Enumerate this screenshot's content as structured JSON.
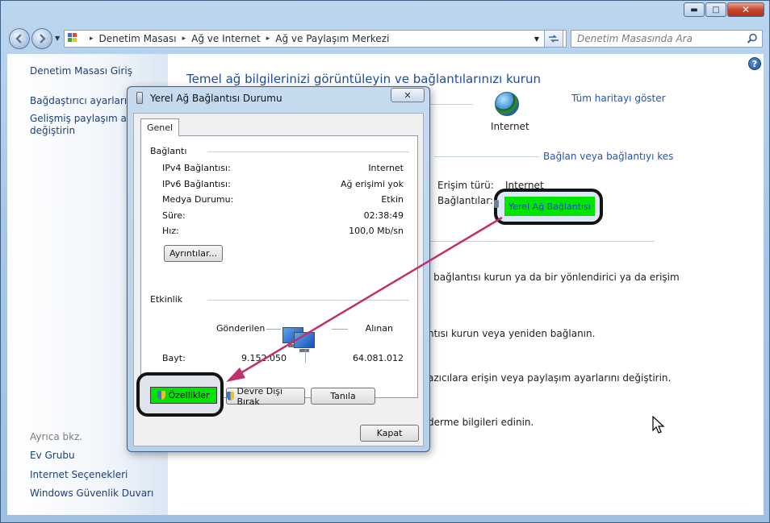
{
  "window": {
    "breadcrumb": [
      "Denetim Masası",
      "Ağ ve Internet",
      "Ağ ve Paylaşım Merkezi"
    ],
    "search_placeholder": "Denetim Masasında Ara",
    "caption_buttons": {
      "minimize": "▬",
      "maximize": "□",
      "close": "✕"
    }
  },
  "sidebar": {
    "home": "Denetim Masası Giriş",
    "items": [
      "Bağdaştırıcı ayarlarını d",
      "Gelişmiş paylaşım ayar",
      "değiştirin"
    ],
    "see_also_label": "Ayrıca bkz.",
    "see_also": [
      "Ev Grubu",
      "Internet Seçenekleri",
      "Windows Güvenlik Duvarı"
    ]
  },
  "main": {
    "title": "Temel ağ bilgilerinizi görüntüleyin ve bağlantılarınızı kurun",
    "full_map_link": "Tüm haritayı göster",
    "internet_label": "Internet",
    "connect_link": "Bağlan veya bağlantıyı kes",
    "access_type_label": "Erişim türü:",
    "access_type_value": "Internet",
    "connections_label": "Bağlantılar:",
    "connection_name": "Yerel Ağ Bağlantısı",
    "tasks": [
      "l bağlantısı kurun ya da bir yönlendirici ya da erişim",
      "ntısı kurun veya yeniden bağlanın.",
      "azıcılara erişin veya paylaşım ayarlarını değiştirin.",
      "derme bilgileri edinin."
    ]
  },
  "dialog": {
    "title": "Yerel Ağ Bağlantısı Durumu",
    "close_glyph": "✕",
    "tab": "Genel",
    "connection_group": "Bağlantı",
    "rows": [
      {
        "label": "IPv4 Bağlantısı:",
        "value": "Internet"
      },
      {
        "label": "IPv6 Bağlantısı:",
        "value": "Ağ erişimi yok"
      },
      {
        "label": "Medya Durumu:",
        "value": "Etkin"
      },
      {
        "label": "Süre:",
        "value": "02:38:49"
      },
      {
        "label": "Hız:",
        "value": "100,0 Mb/sn"
      }
    ],
    "details_button": "Ayrıntılar...",
    "activity_group": "Etkinlik",
    "sent_label": "Gönderilen",
    "received_label": "Alınan",
    "bytes_label": "Bayt:",
    "bytes_sent": "9.152.050",
    "bytes_received": "64.081.012",
    "properties_button": "Özellikler",
    "disable_button": "Devre Dışı Bırak",
    "diagnose_button": "Tanıla",
    "close_button": "Kapat"
  },
  "colors": {
    "highlight_green": "#00e400",
    "annotation_arrow": "#c0306b",
    "link_blue": "#1f56b5",
    "title_blue": "#1e4b9b"
  }
}
